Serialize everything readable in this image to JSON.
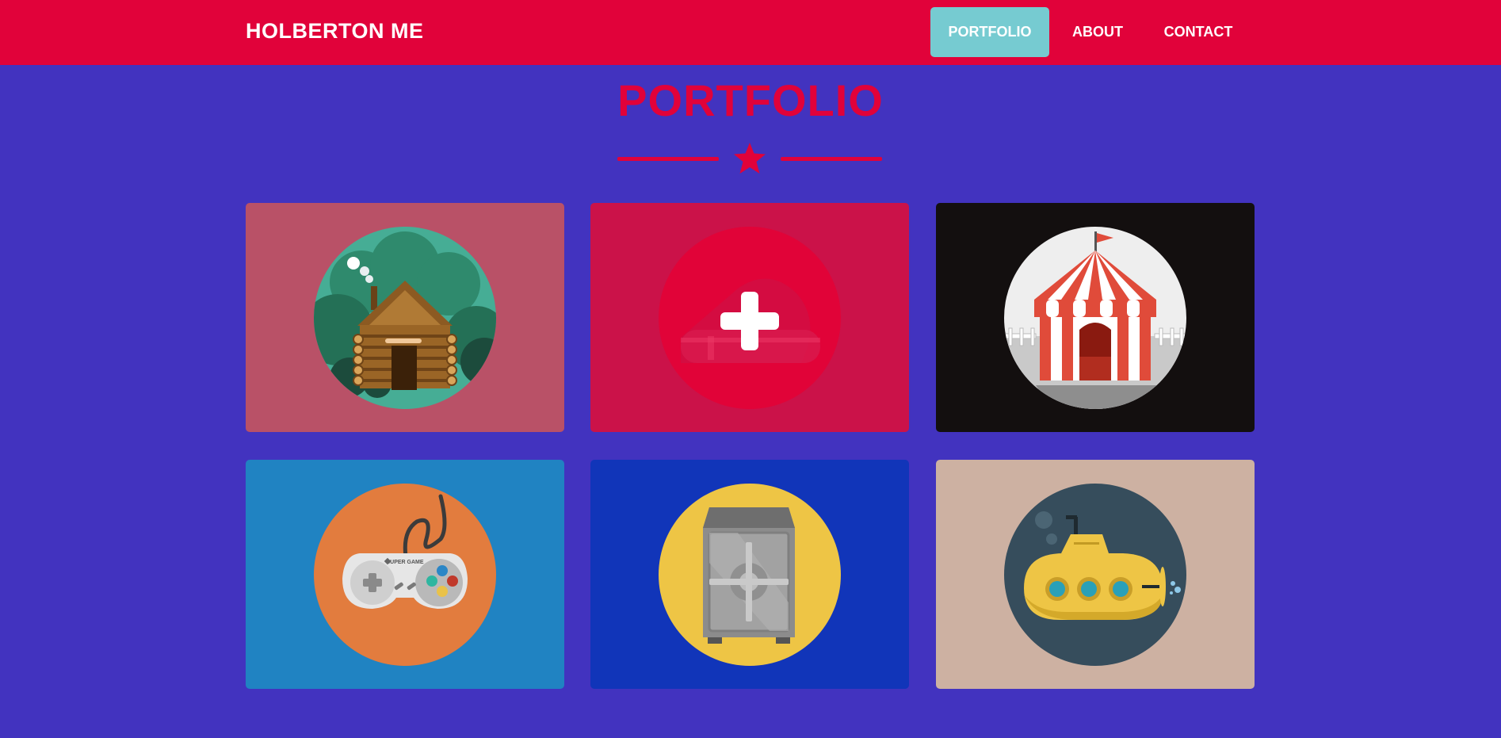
{
  "brand": "HOLBERTON ME",
  "nav": {
    "portfolio": "PORTFOLIO",
    "about": "ABOUT",
    "contact": "CONTACT",
    "active": "PORTFOLIO"
  },
  "section": {
    "title": "PORTFOLIO",
    "divider_icon": "star-icon"
  },
  "portfolio": {
    "items": [
      {
        "icon": "cabin-icon",
        "background": "#b95167"
      },
      {
        "icon": "cake-icon",
        "background": "#cb1249",
        "hover_icon": "plus-icon"
      },
      {
        "icon": "circus-tent-icon",
        "background": "#130f0f"
      },
      {
        "icon": "game-controller-icon",
        "background": "#2083c2"
      },
      {
        "icon": "safe-icon",
        "background": "#1135b9"
      },
      {
        "icon": "submarine-icon",
        "background": "#cdb1a2"
      }
    ],
    "controller_text": "SUPER GAME"
  },
  "colors": {
    "brand_red": "#e1023a",
    "page_background": "#4233bf",
    "active_nav": "#76cbd1"
  }
}
